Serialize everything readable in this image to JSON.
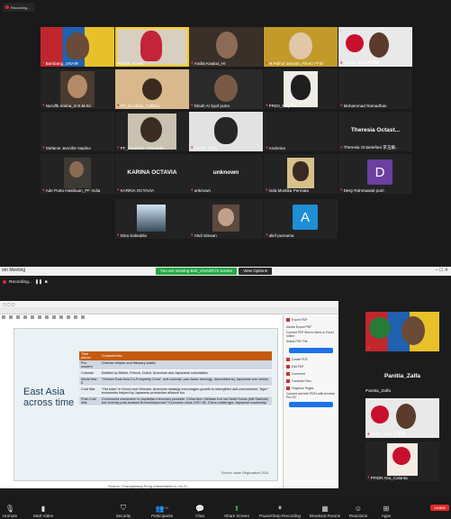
{
  "gallery": {
    "recording_label": "Recording...",
    "tiles": [
      {
        "name": "Bambang_UNAIR",
        "muted": true,
        "speaking": false
      },
      {
        "name": "Panitia_Azzah",
        "muted": false,
        "speaking": true
      },
      {
        "name": "Arafat Kaabui_HI",
        "muted": true,
        "speaking": false
      },
      {
        "name": "M.Palhul Jannah_Fikom FFID",
        "muted": true,
        "speaking": false
      },
      {
        "name": "sanyar_tayu 苏丽娜",
        "muted": true,
        "speaking": false
      },
      {
        "name": "Nuruffti Amina_S.S.M.Sc",
        "muted": true,
        "speaking": false
      },
      {
        "name": "PF_DLAtlasi_Cullima",
        "muted": true,
        "speaking": false
      },
      {
        "name": "Dinah Al Syaf putra",
        "muted": true,
        "speaking": false
      },
      {
        "name": "PRIDI_May Illa",
        "muted": true,
        "speaking": false
      },
      {
        "name": "Mohammad Ramadhan",
        "muted": true,
        "speaking": false
      },
      {
        "name": "Stefanie Jennifer Nadine",
        "muted": true,
        "speaking": false
      },
      {
        "name": "PF_Thailand - Dzinuidin",
        "muted": true,
        "speaking": false
      },
      {
        "name": "Azuitir_Zalfa",
        "muted": true,
        "speaking": false
      },
      {
        "name": "Andreina",
        "muted": true,
        "speaking": false
      },
      {
        "name": "Theresia Octastefani 李玉蘭...",
        "muted": true,
        "speaking": false
      },
      {
        "name": "Ade Putra Hasibuan_PF India",
        "muted": true,
        "speaking": false
      },
      {
        "name": "KARINA OCTAVIA",
        "muted": true,
        "speaking": false
      },
      {
        "name": "unknown",
        "muted": true,
        "speaking": false
      },
      {
        "name": "inda Mustika Permata",
        "muted": true,
        "speaking": false
      },
      {
        "name": "Desy Rahmawati putri",
        "muted": true,
        "speaking": false
      },
      {
        "name": "Dina Salsabila",
        "muted": true,
        "speaking": false
      },
      {
        "name": "Abdi Siswan",
        "muted": true,
        "speaking": false
      },
      {
        "name": "alief purnama",
        "muted": true,
        "speaking": false
      }
    ],
    "big_labels": {
      "theresia": "Theresia Octast...",
      "karina": "KARINA OCTAVIA",
      "unknown": "unknown"
    },
    "avatars": {
      "desy": {
        "letter": "D",
        "color": "#6a3fa0"
      },
      "alief": {
        "letter": "A",
        "color": "#1f8fd6"
      }
    }
  },
  "zoom": {
    "window_title": "om Meeting",
    "share_notice": "You are viewing Bint_UNAIRO's screen",
    "view_options": "View Options",
    "recording_label": "Recording...",
    "slide": {
      "title": "East Asia across time",
      "headers": [
        "Time period",
        "Characteristic"
      ],
      "rows": [
        [
          "Pre-modern",
          "Chinese empire and tributary states"
        ],
        [
          "Colonial",
          "Divided by British, French, Dutch, American and Japanese colonialism"
        ],
        [
          "World War II",
          "\"Greater East Asia Co-Prosperity Zone\", anti-colonial, pan-Asian ideology, discredited by Japanese war crimes"
        ],
        [
          "Cold War",
          "\"Hot wars\" in Korea and Vietnam. American strategy encourages growth to strengthen anti-communism; \"tiger\" economies helped by Japanese production alliance too"
        ],
        [
          "Post-Cold War",
          "Communist conversion to capitalism becomes possible: China then Vietnam but not North Korea (still Stalinist) but recently post-isolated Burma/Myanmar? Economic crisis 1997-98. China challenges Japanese leadership"
        ]
      ],
      "source": "Source: Asian Regionalism 2018",
      "caption": "Source: Changhwang Rung presentation in Jul 21"
    },
    "side_panel_items": [
      "Export PDF",
      "Adobe Export PDF",
      "Convert PDF files to Word or Excel online",
      "Select PDF File",
      "Create PDF",
      "Edit PDF",
      "Comment",
      "Combine Files",
      "Organize Pages",
      "Convert and edit PDFs with Acrobat Pro DC",
      "Start Free Trial"
    ],
    "right_strip": {
      "speaker_name": "Panitia_Zalfa",
      "speaker_label": "Panitia_Zalfa",
      "tile2_name": "rasyar_tayu 苏丽娜",
      "tile3_name": "PFIDR Asa_Calanta"
    },
    "toolbar": [
      {
        "label": "Unmute",
        "icon": "mic-icon"
      },
      {
        "label": "Start Video",
        "icon": "video-icon"
      },
      {
        "label": "Security",
        "icon": "shield-icon"
      },
      {
        "label": "Participants",
        "icon": "participants-icon",
        "badge": "29"
      },
      {
        "label": "Chat",
        "icon": "chat-icon"
      },
      {
        "label": "Share Screen",
        "icon": "share-icon"
      },
      {
        "label": "Pause/Stop Recording",
        "icon": "record-icon"
      },
      {
        "label": "Breakout Rooms",
        "icon": "rooms-icon"
      },
      {
        "label": "Reactions",
        "icon": "reactions-icon"
      },
      {
        "label": "Apps",
        "icon": "apps-icon"
      }
    ],
    "leave_label": "Leave"
  }
}
